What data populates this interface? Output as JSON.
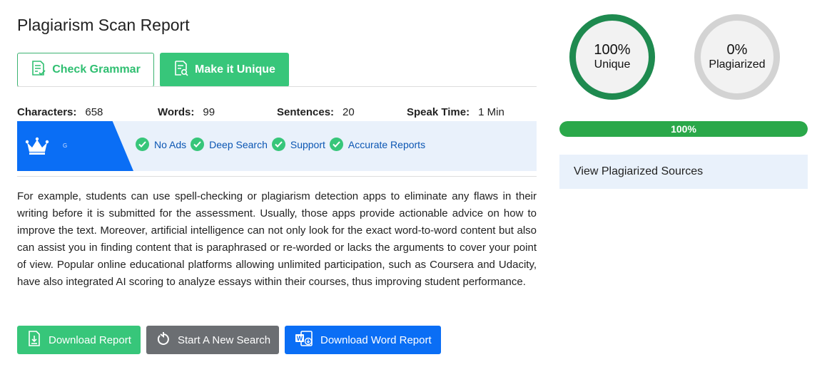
{
  "report": {
    "title": "Plagiarism Scan Report"
  },
  "actions": {
    "check_grammar": "Check Grammar",
    "make_unique": "Make it Unique"
  },
  "stats": [
    {
      "label": "Characters:",
      "value": "658"
    },
    {
      "label": "Words:",
      "value": "99"
    },
    {
      "label": "Sentences:",
      "value": "20"
    },
    {
      "label": "Speak Time:",
      "value": "1 Min"
    }
  ],
  "promo": {
    "badge_letter": "G",
    "features": [
      "No Ads",
      "Deep Search",
      "Support",
      "Accurate Reports"
    ]
  },
  "content": {
    "text": "For example, students can use spell-checking or plagiarism detection apps to eliminate any flaws in their writing before it is submitted for the assessment. Usually, those apps provide actionable advice on how to improve the text. Moreover, artificial intelligence can not only look for the exact word-to-word content but also can assist you in finding content that is paraphrased or re-worded or lacks the arguments to cover your point of view. Popular online educational platforms allowing unlimited participation, such as Coursera and Udacity, have also integrated AI scoring to analyze essays within their courses, thus improving student performance."
  },
  "bottom": {
    "download_report": "Download Report",
    "new_search": "Start A New Search",
    "download_word": "Download Word Report"
  },
  "results": {
    "unique_pct": "100%",
    "unique_label": "Unique",
    "plag_pct": "0%",
    "plag_label": "Plagiarized",
    "progress_label": "100%",
    "progress_value": 1.0,
    "sources_label": "View Plagiarized Sources"
  },
  "colors": {
    "green": "#37c67a",
    "dark_green": "#1e8a4f",
    "blue": "#0a6ef5",
    "gray": "#6b6e72",
    "light_blue_bg": "#e9f1fb"
  },
  "icons": [
    "document-check-icon",
    "document-search-icon",
    "crown-icon",
    "check-circle-icon",
    "download-file-icon",
    "refresh-icon",
    "word-document-icon"
  ]
}
